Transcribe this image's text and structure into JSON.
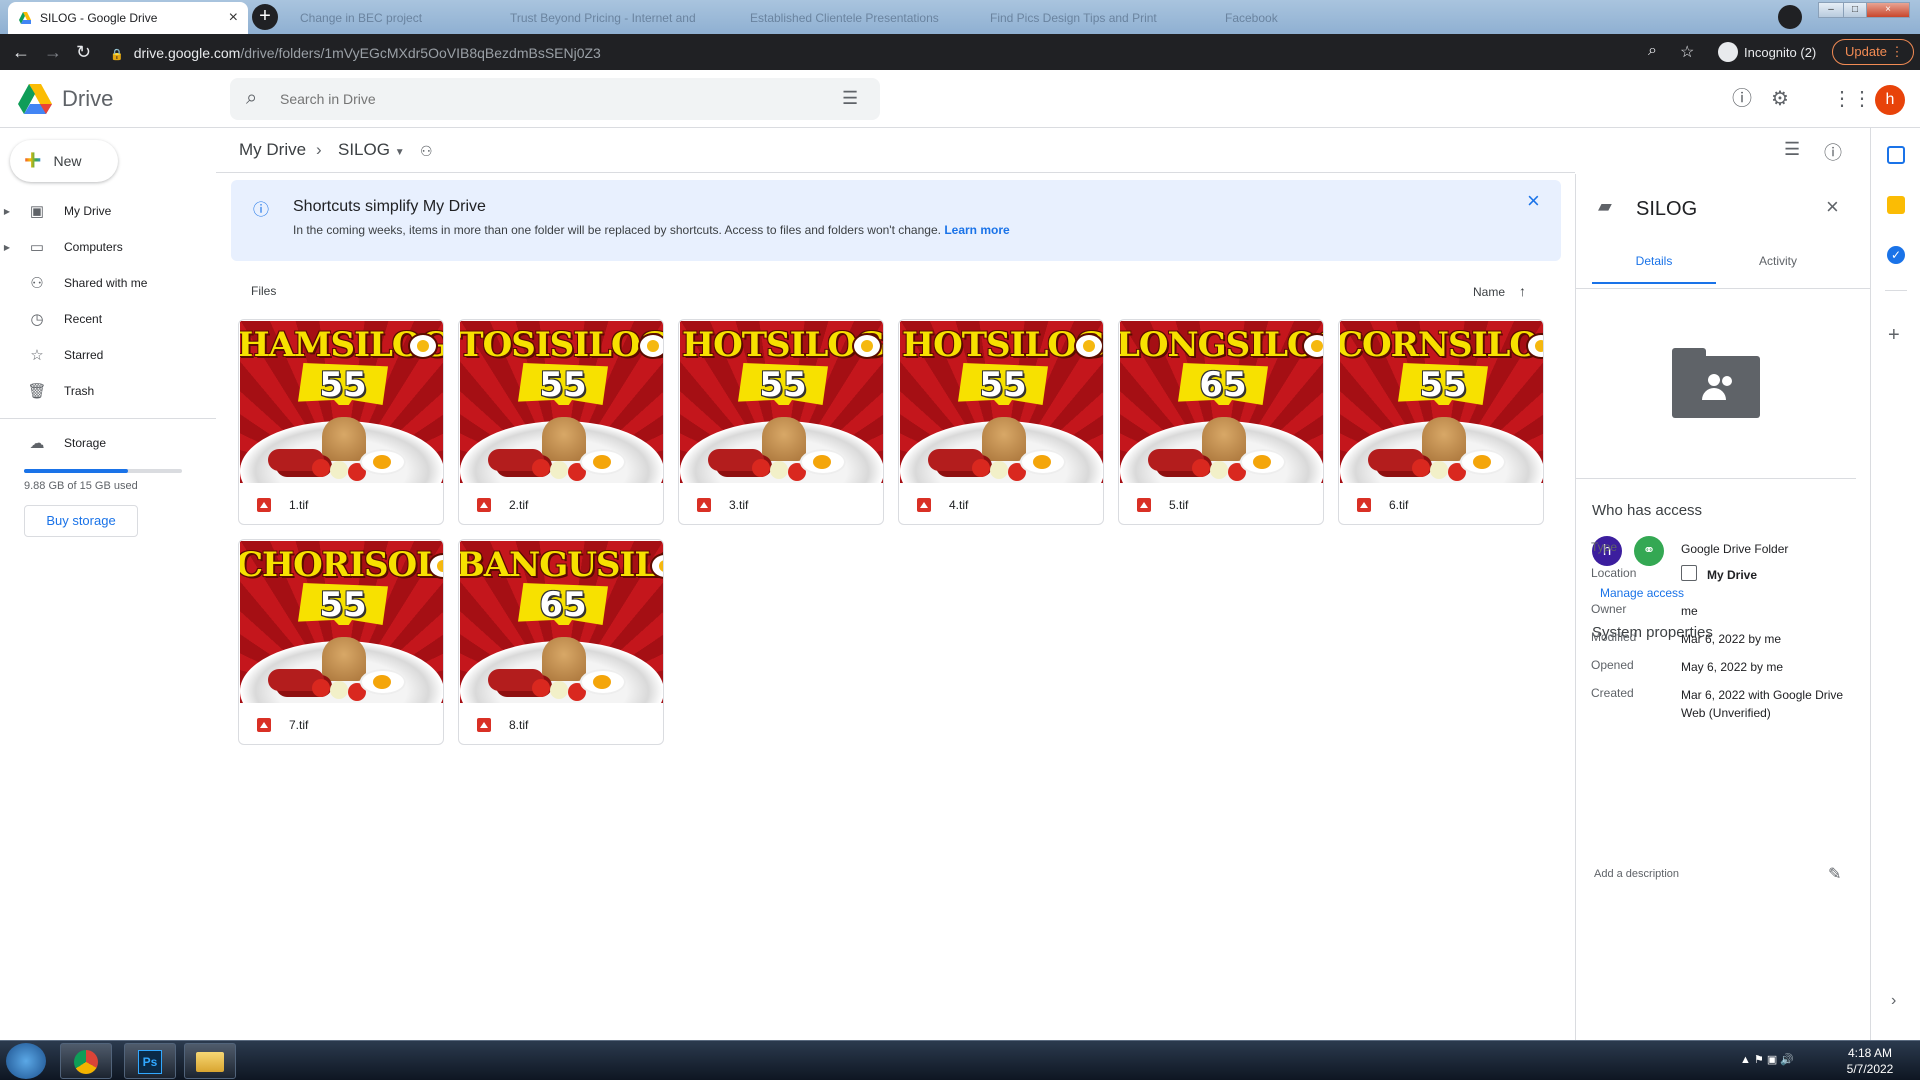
{
  "browser": {
    "active_tab": "SILOG - Google Drive",
    "bg_tabs": [
      "Change in BEC project",
      "Trust Beyond Pricing - Internet and",
      "Established Clientele Presentations",
      "Find Pics Design Tips and Print",
      "Facebook"
    ],
    "url_host": "drive.google.com",
    "url_path": "/drive/folders/1mVyEGcMXdr5OoVIB8qBezdmBsSENj0Z3",
    "incognito": "Incognito (2)",
    "update": "Update"
  },
  "header": {
    "app_name": "Drive",
    "search_placeholder": "Search in Drive",
    "avatar": "h"
  },
  "sidebar": {
    "new_label": "New",
    "items": [
      {
        "label": "My Drive",
        "icon": "my-drive-icon"
      },
      {
        "label": "Computers",
        "icon": "computers-icon"
      },
      {
        "label": "Shared with me",
        "icon": "shared-icon"
      },
      {
        "label": "Recent",
        "icon": "clock-icon"
      },
      {
        "label": "Starred",
        "icon": "star-icon"
      },
      {
        "label": "Trash",
        "icon": "trash-icon"
      }
    ],
    "storage_label": "Storage",
    "storage_used": "9.88 GB of 15 GB used",
    "storage_fraction": 0.66,
    "buy_storage": "Buy storage"
  },
  "breadcrumb": {
    "root": "My Drive",
    "current": "SILOG"
  },
  "banner": {
    "title": "Shortcuts simplify My Drive",
    "text": "In the coming weeks, items in more than one folder will be replaced by shortcuts. Access to files and folders won't change.",
    "link": "Learn more"
  },
  "files_header": {
    "section": "Files",
    "sort": "Name"
  },
  "files": [
    {
      "name": "1.tif",
      "title": "HAMSILOG",
      "price": "55"
    },
    {
      "name": "2.tif",
      "title": "TOSISILOG",
      "price": "55"
    },
    {
      "name": "3.tif",
      "title": "HOTSILOG",
      "price": "55"
    },
    {
      "name": "4.tif",
      "title": "HOTSILOG",
      "price": "55"
    },
    {
      "name": "5.tif",
      "title": "LONGSILOG",
      "price": "65"
    },
    {
      "name": "6.tif",
      "title": "CORNSILOG",
      "price": "55"
    },
    {
      "name": "7.tif",
      "title": "CHORISOLOG",
      "price": "55"
    },
    {
      "name": "8.tif",
      "title": "BANGUSILOG",
      "price": "65"
    }
  ],
  "details": {
    "folder": "SILOG",
    "tab_details": "Details",
    "tab_activity": "Activity",
    "who_has_access": "Who has access",
    "access_avatar": "h",
    "manage_access": "Manage access",
    "system_properties": "System properties",
    "props": [
      {
        "label": "Type",
        "value": "Google Drive Folder"
      },
      {
        "label": "Location",
        "value": "My Drive"
      },
      {
        "label": "Owner",
        "value": "me"
      },
      {
        "label": "Modified",
        "value": "Mar 6, 2022 by me"
      },
      {
        "label": "Opened",
        "value": "May 6, 2022 by me"
      },
      {
        "label": "Created",
        "value": "Mar 6, 2022 with Google Drive Web (Unverified)"
      }
    ],
    "add_description": "Add a description"
  },
  "taskbar": {
    "time": "4:18 AM",
    "date": "5/7/2022"
  }
}
